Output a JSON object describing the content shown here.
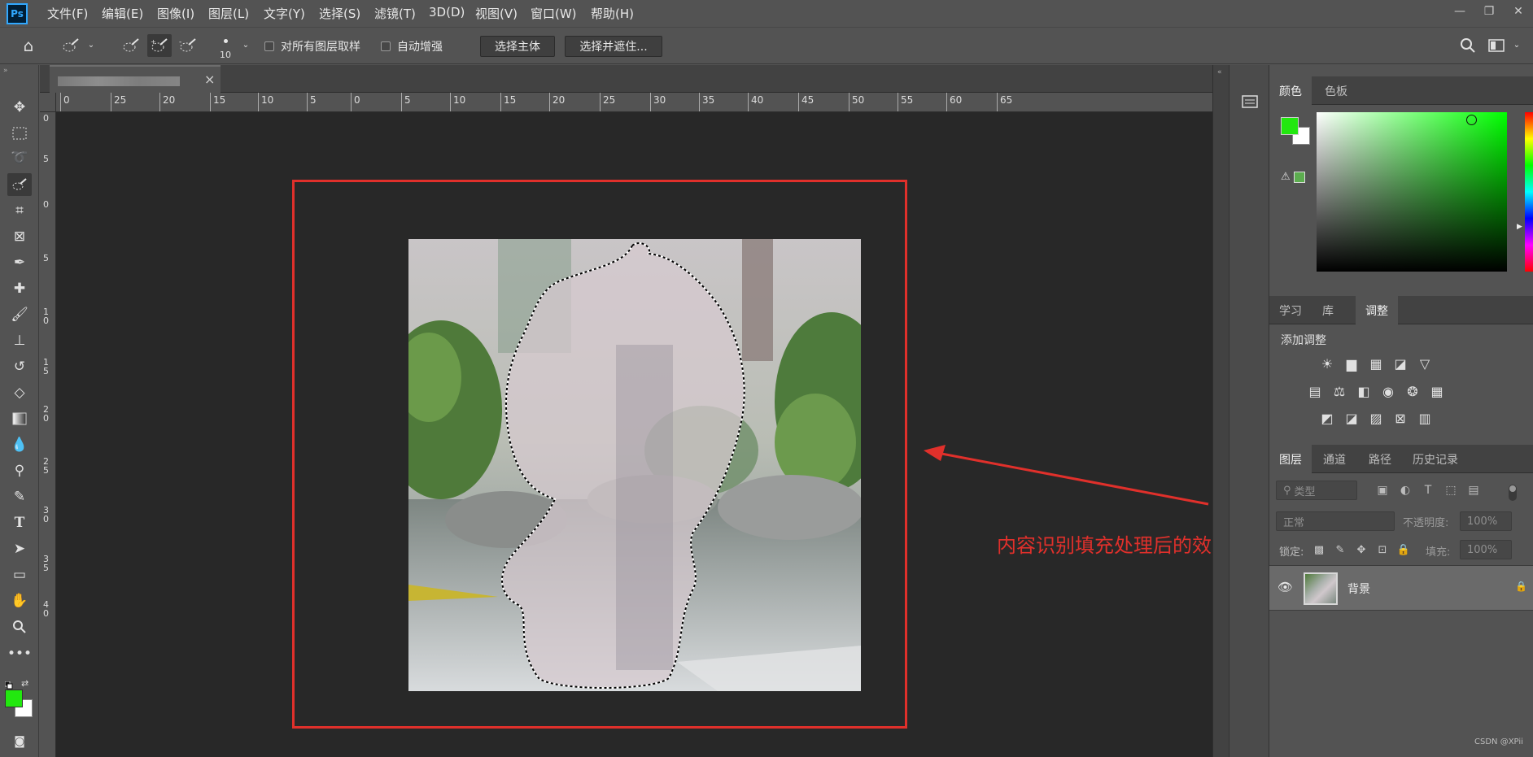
{
  "app": {
    "logo_text": "Ps"
  },
  "menu": [
    "文件(F)",
    "编辑(E)",
    "图像(I)",
    "图层(L)",
    "文字(Y)",
    "选择(S)",
    "滤镜(T)",
    "3D(D)",
    "视图(V)",
    "窗口(W)",
    "帮助(H)"
  ],
  "window_controls": {
    "minimize": "—",
    "restore": "❐",
    "close": "✕"
  },
  "options": {
    "brush_size": "10",
    "sample_all_layers_label": "对所有图层取样",
    "auto_enhance_label": "自动增强",
    "select_subject_label": "选择主体",
    "select_and_mask_label": "选择并遮住..."
  },
  "document": {
    "tab_close": "×"
  },
  "ruler": {
    "h_labels": [
      "0",
      "25",
      "20",
      "15",
      "10",
      "5",
      "0",
      "5",
      "10",
      "15",
      "20",
      "25",
      "30",
      "35",
      "40",
      "45",
      "50",
      "55",
      "60",
      "65"
    ],
    "v_labels": [
      "0",
      "5",
      "0",
      "5",
      "1 0",
      "1 5",
      "2 0",
      "2 5",
      "3 0",
      "3 5",
      "4 0"
    ]
  },
  "annotation": {
    "text": "内容识别填充处理后的效果"
  },
  "panels": {
    "color_tabs": [
      "颜色",
      "色板"
    ],
    "learn_tabs": [
      "学习",
      "库",
      "调整"
    ],
    "adjustments_title": "添加调整",
    "layers_tabs": [
      "图层",
      "通道",
      "路径",
      "历史记录"
    ],
    "filter_kind": "类型",
    "blend_mode": "正常",
    "opacity_label": "不透明度:",
    "opacity_value": "100%",
    "lock_label": "锁定:",
    "fill_label": "填充:",
    "fill_value": "100%",
    "layer_name": "背景"
  },
  "colors": {
    "foreground": "#22e80f",
    "background": "#ffffff",
    "annotation_red": "#e0302b"
  },
  "watermark": "CSDN @XPii"
}
